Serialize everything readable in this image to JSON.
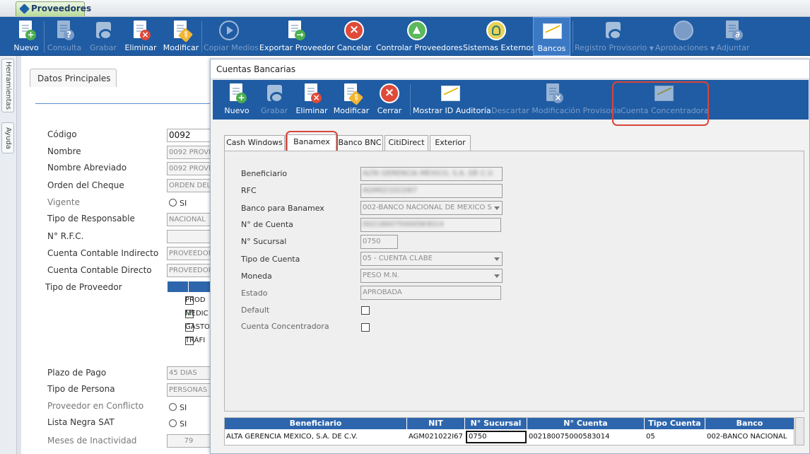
{
  "app_tab": {
    "label": "Proveedores"
  },
  "main_toolbar": [
    {
      "id": "nuevo",
      "label": "Nuevo",
      "icon": "new-doc-icon",
      "disabled": false
    },
    {
      "id": "consulta",
      "label": "Consulta",
      "icon": "query-doc-icon",
      "disabled": true
    },
    {
      "id": "grabar",
      "label": "Grabar",
      "icon": "save-icon",
      "disabled": true
    },
    {
      "id": "eliminar",
      "label": "Eliminar",
      "icon": "delete-doc-icon",
      "disabled": false
    },
    {
      "id": "modificar",
      "label": "Modificar",
      "icon": "edit-doc-icon",
      "disabled": false
    },
    {
      "id": "copiar",
      "label": "Copiar Medios",
      "icon": "play-icon",
      "disabled": true
    },
    {
      "id": "exportar",
      "label": "Exportar Proveedor",
      "icon": "export-doc-icon",
      "disabled": false
    },
    {
      "id": "cancelar",
      "label": "Cancelar",
      "icon": "cancel-icon",
      "disabled": false
    },
    {
      "id": "controlar",
      "label": "Controlar Proveedores",
      "icon": "thumbs-up-icon",
      "disabled": false
    },
    {
      "id": "sistemas",
      "label": "Sistemas Externos",
      "icon": "external-systems-icon",
      "disabled": false
    },
    {
      "id": "bancos",
      "label": "Bancos",
      "icon": "chart-icon",
      "disabled": false,
      "active": true
    },
    {
      "id": "registro",
      "label": "Registro Provisorio",
      "icon": "save-icon",
      "disabled": true,
      "caret": true
    },
    {
      "id": "aprobaciones",
      "label": "Aprobaciones",
      "icon": "approval-icon",
      "disabled": true,
      "caret": true
    },
    {
      "id": "adjuntar",
      "label": "Adjuntar",
      "icon": "attach-doc-icon",
      "disabled": true
    }
  ],
  "side_tabs": {
    "herramientas": "Herramientas",
    "ayuda": "Ayuda"
  },
  "main_form": {
    "tab_label": "Datos Principales",
    "labels": {
      "codigo": "Código",
      "nombre": "Nombre",
      "nombre_abreviado": "Nombre Abreviado",
      "orden_cheque": "Orden del Cheque",
      "vigente": "Vigente",
      "tipo_responsable": "Tipo de Responsable",
      "rfc": "N° R.F.C.",
      "cuenta_indirecto": "Cuenta Contable Indirecto",
      "cuenta_directo": "Cuenta Contable Directo",
      "tipo_proveedor": "Tipo de Proveedor",
      "plazo_pago": "Plazo de Pago",
      "tipo_persona": "Tipo de Persona",
      "conflicto": "Proveedor en Conflicto",
      "lista_negra": "Lista Negra SAT",
      "meses_inactividad": "Meses de Inactividad"
    },
    "values": {
      "codigo": "0092",
      "nombre": "0092 PROVE",
      "nombre_abreviado": "0092 PROVE",
      "orden_cheque": "ORDEN DEL",
      "tipo_responsable": "NACIONAL",
      "rfc": "",
      "cuenta_indirecto": "PROVEEDOR",
      "cuenta_directo": "PROVEEDOR",
      "plazo_pago": "45 DIAS",
      "tipo_persona": "PERSONAS M",
      "meses_inactividad": "79"
    },
    "radio_si": "SI",
    "tipo_proveedor_items": [
      {
        "label": "PROD",
        "checked": false
      },
      {
        "label": "MEDIC",
        "checked": true
      },
      {
        "label": "GASTO",
        "checked": false
      },
      {
        "label": "TRÁFI",
        "checked": false
      }
    ]
  },
  "dialog": {
    "title": "Cuentas Bancarias",
    "toolbar": [
      {
        "id": "nuevo",
        "label": "Nuevo",
        "icon": "new-doc-icon",
        "disabled": false
      },
      {
        "id": "grabar",
        "label": "Grabar",
        "icon": "save-icon",
        "disabled": true
      },
      {
        "id": "eliminar",
        "label": "Eliminar",
        "icon": "delete-doc-icon",
        "disabled": false
      },
      {
        "id": "modificar",
        "label": "Modificar",
        "icon": "edit-doc-icon",
        "disabled": false
      },
      {
        "id": "cerrar",
        "label": "Cerrar",
        "icon": "close-icon",
        "disabled": false
      },
      {
        "id": "auditoria",
        "label": "Mostrar ID Auditoría",
        "icon": "chart-icon",
        "disabled": false
      },
      {
        "id": "descartar",
        "label": "Descartar Modificación Provisoria",
        "icon": "discard-doc-icon",
        "disabled": true
      },
      {
        "id": "concentradora",
        "label": "Cuenta Concentradora",
        "icon": "chart-icon",
        "disabled": true,
        "highlighted": true
      }
    ],
    "tabs": [
      {
        "label": "Cash Windows"
      },
      {
        "label": "Banamex",
        "active": true
      },
      {
        "label": "Banco BNC"
      },
      {
        "label": "CitiDirect"
      },
      {
        "label": "Exterior"
      }
    ],
    "form": {
      "labels": {
        "beneficiario": "Beneficiario",
        "rfc": "RFC",
        "banco": "Banco para Banamex",
        "cuenta": "N° de Cuenta",
        "sucursal": "N° Sucursal",
        "tipo_cuenta": "Tipo de Cuenta",
        "moneda": "Moneda",
        "estado": "Estado",
        "default": "Default",
        "concentradora": "Cuenta Concentradora"
      },
      "values": {
        "beneficiario": "ALTA GERENCIA MEXICO, S.A. DE C.V.",
        "rfc": "AGM021022I67",
        "banco": "002-BANCO NACIONAL DE MEXICO S",
        "cuenta": "002180075000583014",
        "sucursal": "0750",
        "tipo_cuenta": "05 - CUENTA CLABE",
        "moneda": "PESO M.N.",
        "estado": "APROBADA"
      }
    },
    "grid": {
      "columns": [
        "Beneficiario",
        "NIT",
        "N° Sucursal",
        "N° Cuenta",
        "Tipo Cuenta",
        "Banco"
      ],
      "rows": [
        [
          "ALTA GERENCIA MEXICO, S.A. DE C.V.",
          "AGM021022I67",
          "0750",
          "002180075000583014",
          "05",
          "002-BANCO NACIONAL"
        ]
      ]
    }
  }
}
